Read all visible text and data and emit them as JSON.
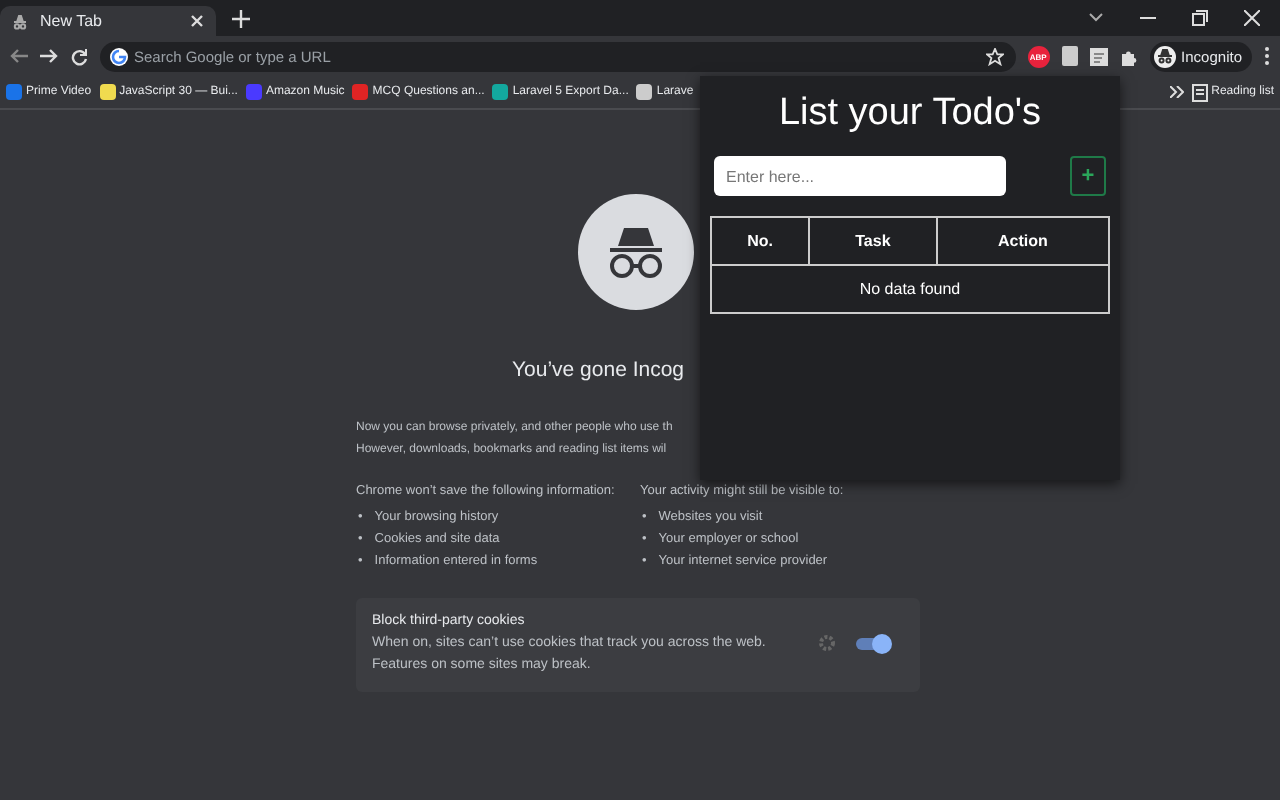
{
  "tabs": [
    {
      "title": "New Tab",
      "selected": true
    }
  ],
  "toolbar": {
    "omnibox_placeholder": "Search Google or type a URL",
    "extension_badge": "ABP",
    "profile": "Incognito"
  },
  "bookmarks": [
    {
      "label": "Prime Video",
      "color": "#1a73e8"
    },
    {
      "label": "JavaScript 30 — Bui...",
      "color": "#f0db4f"
    },
    {
      "label": "Amazon Music",
      "color": "#4a3aff"
    },
    {
      "label": "MCQ Questions an...",
      "color": "#e02424"
    },
    {
      "label": "Laravel 5 Export Da...",
      "color": "#13a89e"
    },
    {
      "label": "Larave",
      "color": "#cccccc"
    }
  ],
  "reading_list": "Reading list",
  "page": {
    "heading": "You’ve gone Incog",
    "intro": [
      "Now you can browse privately, and other people who use th",
      "However, downloads, bookmarks and reading list items wil"
    ],
    "bullet": "•",
    "columns": [
      {
        "title": "Chrome won’t save the following information:",
        "items": [
          "Your browsing history",
          "Cookies and site data",
          "Information entered in forms"
        ]
      },
      {
        "title": "Your activity might still be visible to:",
        "items": [
          "Websites you visit",
          "Your employer or school",
          "Your internet service provider"
        ]
      }
    ],
    "cookie_card": {
      "title": "Block third-party cookies",
      "text": "When on, sites can’t use cookies that track you across the web. Features on some sites may break.",
      "on": true
    }
  },
  "popup": {
    "title": "List your Todo's",
    "input_placeholder": "Enter here...",
    "add_button": "+",
    "columns": [
      "No.",
      "Task",
      "Action"
    ],
    "empty_message": "No data found"
  }
}
